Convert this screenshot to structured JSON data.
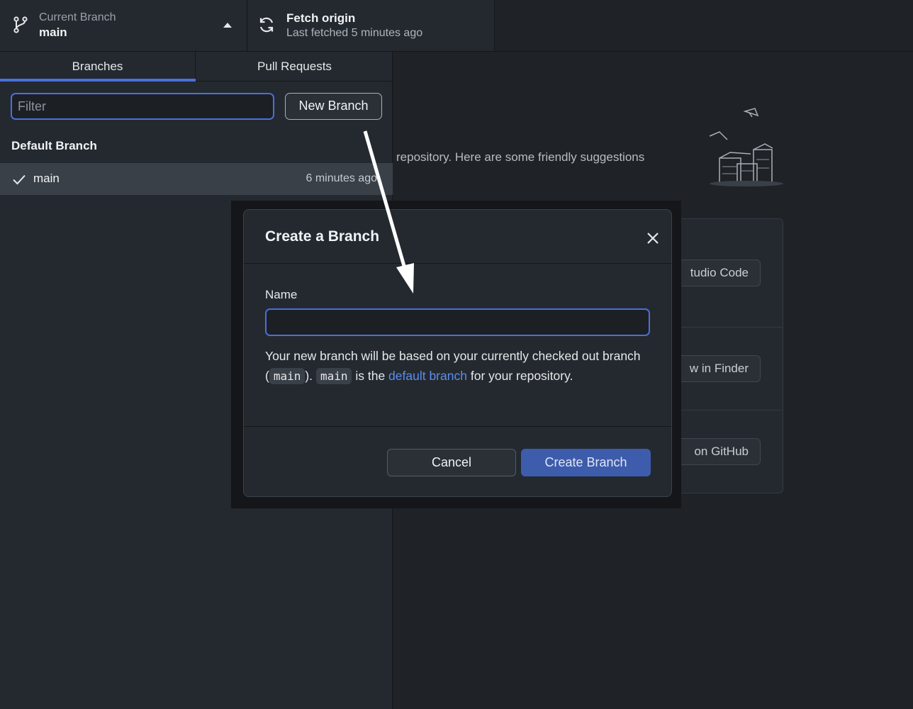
{
  "toolbar": {
    "branch": {
      "label": "Current Branch",
      "value": "main",
      "icon": "git-branch-icon"
    },
    "fetch": {
      "label": "Fetch origin",
      "value": "Last fetched 5 minutes ago",
      "icon": "sync-icon"
    }
  },
  "branch_panel": {
    "tabs": [
      {
        "label": "Branches",
        "active": true
      },
      {
        "label": "Pull Requests",
        "active": false
      }
    ],
    "filter": {
      "placeholder": "Filter",
      "value": ""
    },
    "new_branch_label": "New Branch",
    "section_title": "Default Branch",
    "branches": [
      {
        "name": "main",
        "time": "6 minutes ago",
        "checked": true
      }
    ]
  },
  "background": {
    "suggestion_text": "repository. Here are some friendly suggestions",
    "actions": [
      {
        "label": "tudio Code"
      },
      {
        "label": "w in Finder"
      },
      {
        "label": "on GitHub"
      }
    ]
  },
  "dialog": {
    "title": "Create a Branch",
    "name_label": "Name",
    "name_value": "",
    "desc_part1": "Your new branch will be based on your currently checked out branch (",
    "desc_code1": "main",
    "desc_part2": ").",
    "desc_code2": "main",
    "desc_part3": "is the",
    "desc_link": "default branch",
    "desc_part4": "for your repository.",
    "cancel_label": "Cancel",
    "create_label": "Create Branch"
  },
  "colors": {
    "accent": "#4a6fdc",
    "primary_button": "#3d5cab",
    "link": "#5b8def"
  }
}
